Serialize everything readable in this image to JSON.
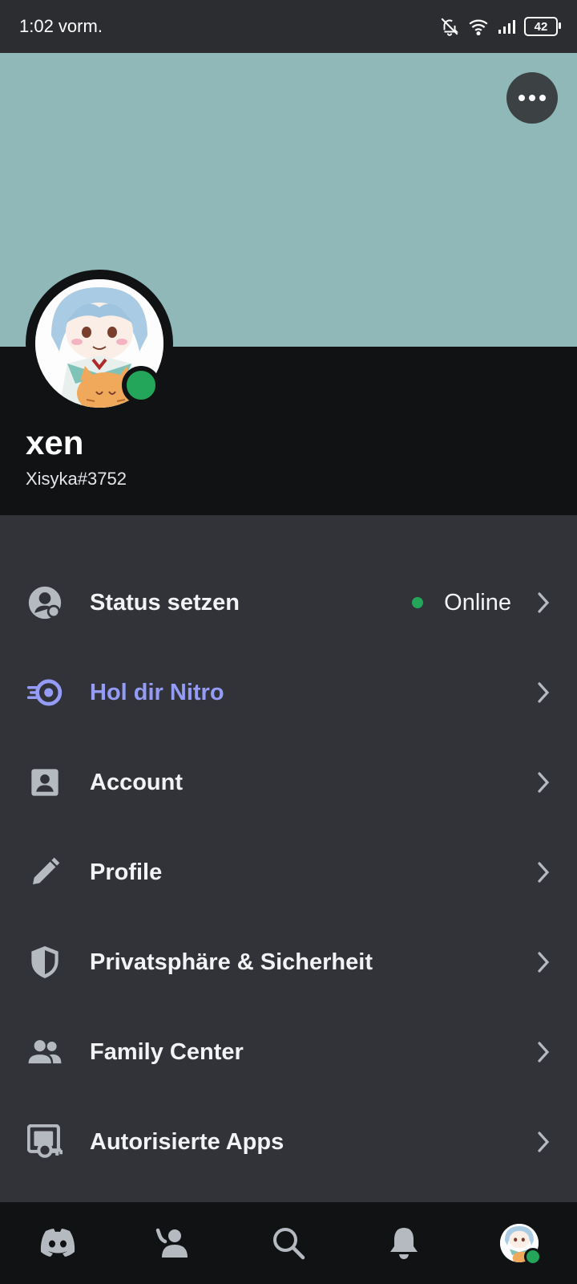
{
  "status_bar": {
    "time": "1:02 vorm.",
    "battery": "42"
  },
  "profile": {
    "display_name": "xen",
    "username": "Xisyka#3752",
    "status": "Online"
  },
  "menu": {
    "items": [
      {
        "label": "Status setzen",
        "value": "Online",
        "icon": "status-person-icon"
      },
      {
        "label": "Hol dir Nitro",
        "icon": "nitro-icon"
      },
      {
        "label": "Account",
        "icon": "account-card-icon"
      },
      {
        "label": "Profile",
        "icon": "pencil-icon"
      },
      {
        "label": "Privatsphäre & Sicherheit",
        "icon": "shield-icon"
      },
      {
        "label": "Family Center",
        "icon": "people-icon"
      },
      {
        "label": "Autorisierte Apps",
        "icon": "authorized-apps-icon"
      }
    ]
  },
  "bottom_nav": [
    "discord-home-icon",
    "friends-icon",
    "search-icon",
    "notifications-bell-icon",
    "profile-avatar"
  ],
  "colors": {
    "background": "#313338",
    "banner": "#91b8b8",
    "panel": "#111214",
    "online": "#23a55a",
    "nitro": "#949cf7"
  }
}
